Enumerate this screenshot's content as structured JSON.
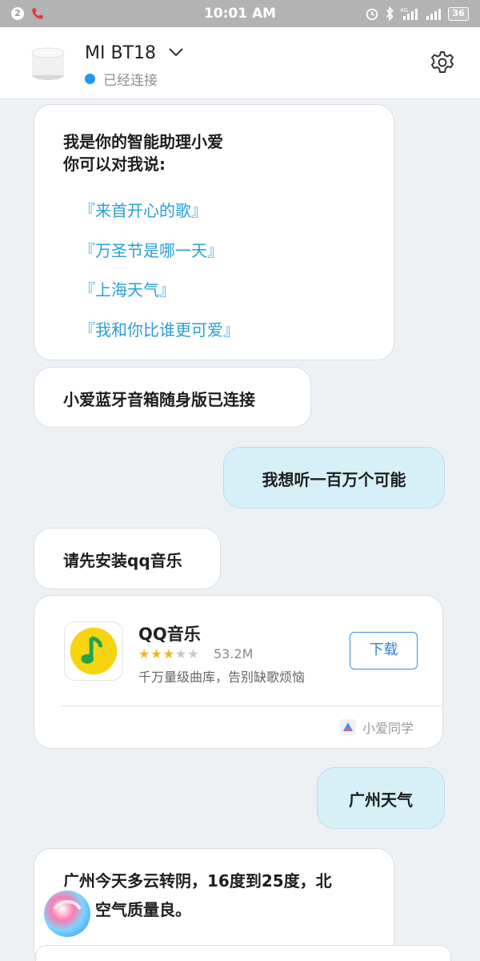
{
  "status_bar": {
    "notification_count": "2",
    "time": "10:01 AM",
    "network_label": "4G",
    "battery": "36"
  },
  "header": {
    "device_name": "MI BT18",
    "connection_status": "已经连接",
    "status_color": "#2196f3"
  },
  "chat": {
    "welcome": {
      "line1": "我是你的智能助理小爱",
      "line2": "你可以对我说:",
      "suggestions": [
        "『来首开心的歌』",
        "『万圣节是哪一天』",
        "『上海天气』",
        "『我和你比谁更可爱』"
      ]
    },
    "msg_connected": "小爱蓝牙音箱随身版已连接",
    "msg_user_song": "我想听一百万个可能",
    "msg_install": "请先安装qq音乐",
    "app_card": {
      "name": "QQ音乐",
      "rating": 3,
      "rating_max": 5,
      "size": "53.2M",
      "description": "千万量级曲库，告别缺歌烦恼",
      "download_label": "下载",
      "source_label": "小爱同学"
    },
    "msg_user_weather": "广州天气",
    "msg_weather_reply": "广州今天多云转阴，16度到25度，北　　级，空气质量良。"
  },
  "colors": {
    "accent_blue": "#2a9fd6",
    "user_bubble": "#d7f0f8",
    "star": "#f5b80e"
  }
}
